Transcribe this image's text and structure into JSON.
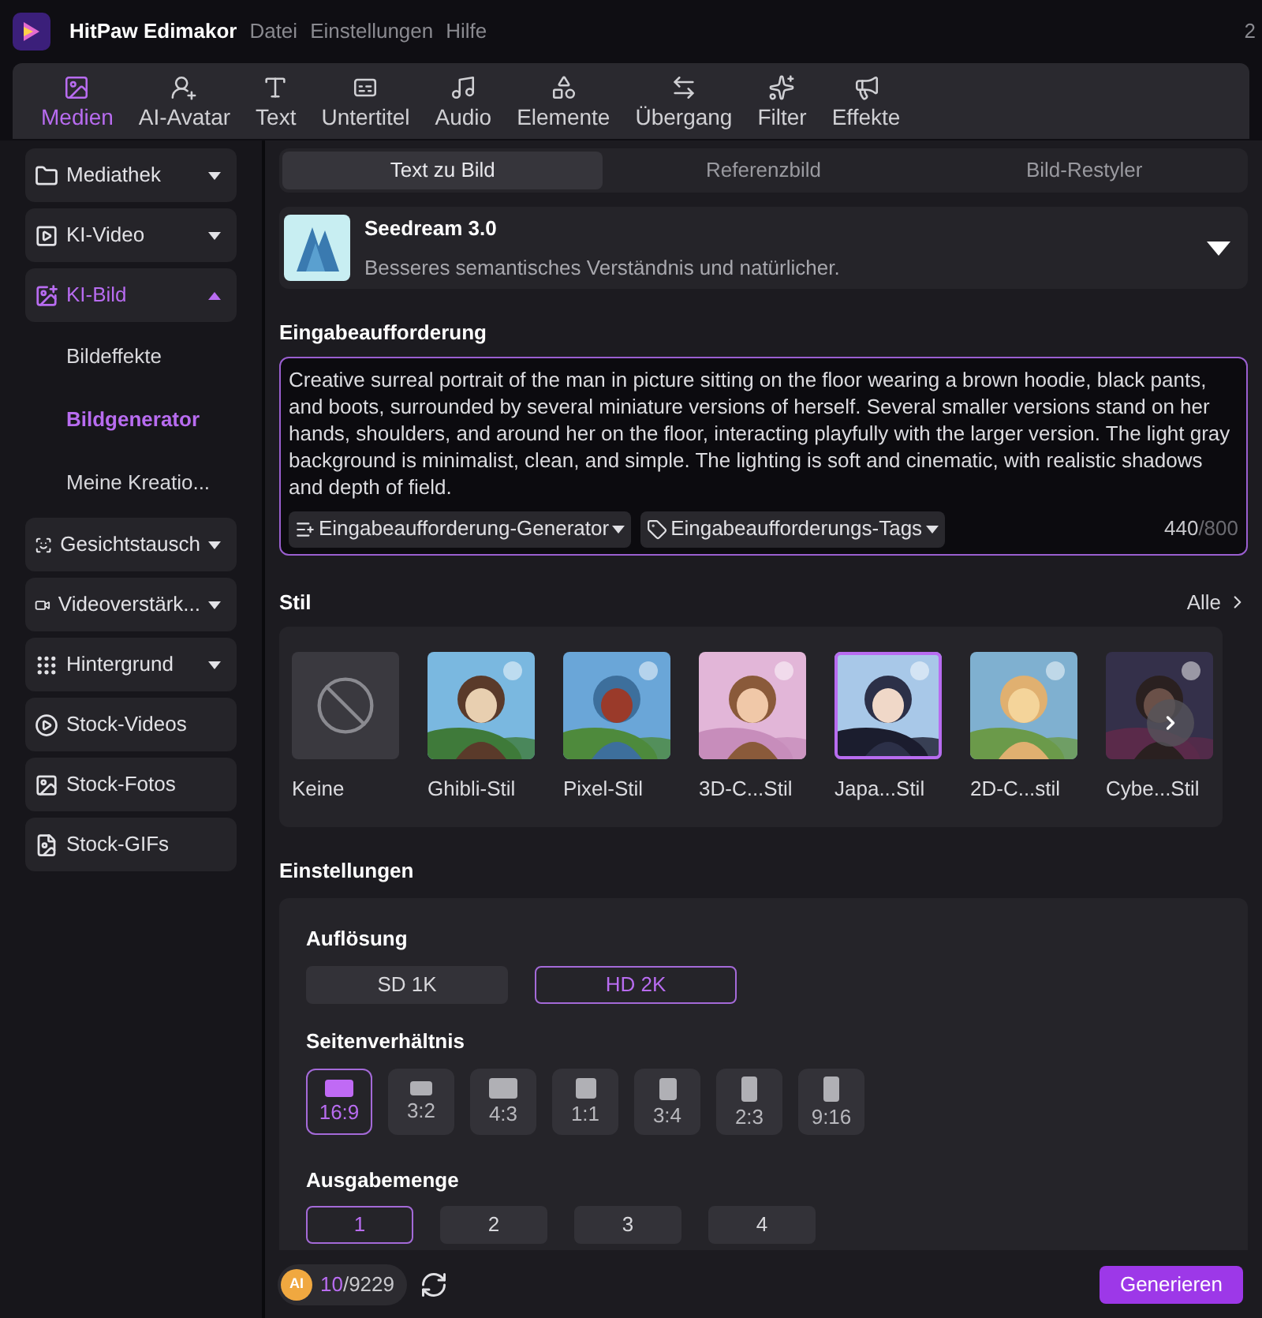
{
  "title_bar": {
    "app_name": "HitPaw Edimakor",
    "menu": [
      "Datei",
      "Einstellungen",
      "Hilfe"
    ],
    "edge_text": "2"
  },
  "toolbar": [
    {
      "label": "Medien",
      "selected": true
    },
    {
      "label": "AI-Avatar",
      "selected": false
    },
    {
      "label": "Text",
      "selected": false
    },
    {
      "label": "Untertitel",
      "selected": false
    },
    {
      "label": "Audio",
      "selected": false
    },
    {
      "label": "Elemente",
      "selected": false
    },
    {
      "label": "Übergang",
      "selected": false
    },
    {
      "label": "Filter",
      "selected": false
    },
    {
      "label": "Effekte",
      "selected": false
    }
  ],
  "sidebar": {
    "items": [
      {
        "label": "Mediathek",
        "selected": false,
        "expanded": false
      },
      {
        "label": "KI-Video",
        "selected": false,
        "expanded": false
      },
      {
        "label": "KI-Bild",
        "selected": true,
        "expanded": true,
        "children": [
          {
            "label": "Bildeffekte",
            "selected": false
          },
          {
            "label": "Bildgenerator",
            "selected": true
          },
          {
            "label": "Meine Kreatio...",
            "selected": false
          }
        ]
      },
      {
        "label": "Gesichtstausch",
        "selected": false,
        "expanded": false
      },
      {
        "label": "Videoverstärk...",
        "selected": false,
        "expanded": false
      },
      {
        "label": "Hintergrund",
        "selected": false,
        "expanded": false
      },
      {
        "label": "Stock-Videos",
        "selected": false
      },
      {
        "label": "Stock-Fotos",
        "selected": false
      },
      {
        "label": "Stock-GIFs",
        "selected": false
      }
    ]
  },
  "mode_tabs": [
    {
      "label": "Text zu Bild",
      "selected": true
    },
    {
      "label": "Referenzbild",
      "selected": false
    },
    {
      "label": "Bild-Restyler",
      "selected": false
    }
  ],
  "model": {
    "name": "Seedream 3.0",
    "description": "Besseres semantisches Verständnis und natürlicher."
  },
  "prompt": {
    "label": "Eingabeaufforderung",
    "value": "Creative surreal portrait of the man in picture sitting on the floor wearing a brown hoodie, black pants, and boots, surrounded by several miniature versions of herself. Several smaller versions stand on her hands, shoulders, and around her on the floor, interacting playfully with the larger version. The light gray background is minimalist, clean, and simple. The lighting is soft and cinematic, with realistic shadows and depth of field.",
    "generator_button": "Eingabeaufforderung-Generator",
    "tags_button": "Eingabeaufforderungs-Tags",
    "count": "440",
    "max": "/800"
  },
  "style": {
    "label": "Stil",
    "all_link": "Alle",
    "items": [
      {
        "label": "Keine",
        "kind": "none",
        "selected": false
      },
      {
        "label": "Ghibli-Stil",
        "kind": "picture",
        "selected": false
      },
      {
        "label": "Pixel-Stil",
        "kind": "picture",
        "selected": false
      },
      {
        "label": "3D-C...Stil",
        "kind": "picture",
        "selected": false
      },
      {
        "label": "Japa...Stil",
        "kind": "picture",
        "selected": true
      },
      {
        "label": "2D-C...stil",
        "kind": "picture",
        "selected": false
      },
      {
        "label": "Cybe...Stil",
        "kind": "picture",
        "selected": false
      }
    ]
  },
  "settings": {
    "label": "Einstellungen",
    "resolution": {
      "label": "Auflösung",
      "options": [
        {
          "label": "SD 1K",
          "selected": false
        },
        {
          "label": "HD 2K",
          "selected": true
        }
      ]
    },
    "aspect_ratio": {
      "label": "Seitenverhältnis",
      "options": [
        {
          "label": "16:9",
          "selected": true
        },
        {
          "label": "3:2",
          "selected": false
        },
        {
          "label": "4:3",
          "selected": false
        },
        {
          "label": "1:1",
          "selected": false
        },
        {
          "label": "3:4",
          "selected": false
        },
        {
          "label": "2:3",
          "selected": false
        },
        {
          "label": "9:16",
          "selected": false
        }
      ]
    },
    "output_count": {
      "label": "Ausgabemenge",
      "options": [
        {
          "label": "1",
          "selected": true
        },
        {
          "label": "2",
          "selected": false
        },
        {
          "label": "3",
          "selected": false
        },
        {
          "label": "4",
          "selected": false
        }
      ]
    }
  },
  "footer": {
    "credits_badge": "AI",
    "credits_used": "10",
    "credits_total": "/9229",
    "generate_button": "Generieren"
  }
}
